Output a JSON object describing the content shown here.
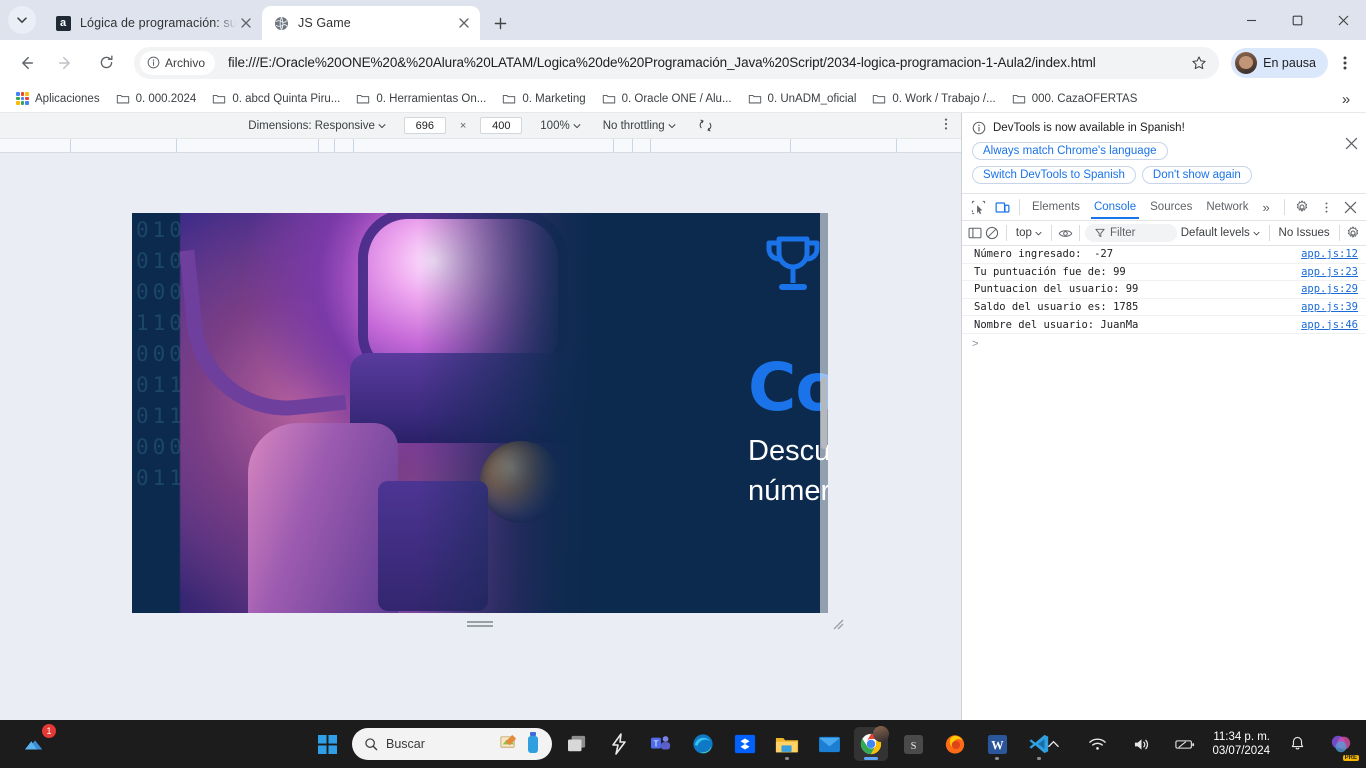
{
  "browser": {
    "tabs": [
      {
        "title": "Lógica de programación: sumér",
        "favicon": "alura-icon",
        "active": false
      },
      {
        "title": "JS Game",
        "favicon": "globe-icon",
        "active": true
      }
    ],
    "new_tab_label": "+",
    "omnibox": {
      "chip_label": "Archivo",
      "url": "file:///E:/Oracle%20ONE%20&%20Alura%20LATAM/Logica%20de%20Programación_Java%20Script/2034-logica-programacion-1-Aula2/index.html"
    },
    "profile_label": "En pausa",
    "bookmarks": [
      {
        "label": "Aplicaciones",
        "icon": "apps-grid-icon"
      },
      {
        "label": "0. 000.2024",
        "icon": "folder-icon"
      },
      {
        "label": "0. abcd Quinta Piru...",
        "icon": "folder-icon"
      },
      {
        "label": "0. Herramientas On...",
        "icon": "folder-icon"
      },
      {
        "label": "0. Marketing",
        "icon": "folder-icon"
      },
      {
        "label": "0. Oracle ONE / Alu...",
        "icon": "folder-icon"
      },
      {
        "label": "0. UnADM_oficial",
        "icon": "folder-icon"
      },
      {
        "label": "0. Work / Trabajo /...",
        "icon": "folder-icon"
      },
      {
        "label": "000. CazaOFERTAS",
        "icon": "folder-icon"
      }
    ],
    "bookmarks_overflow": "»"
  },
  "device_toolbar": {
    "dimensions_label": "Dimensions: Responsive",
    "width": "696",
    "height": "400",
    "multiply": "×",
    "zoom": "100%",
    "throttling": "No throttling"
  },
  "page": {
    "heading": "Comienza el juego",
    "paragraph_line1": "Descubre el",
    "paragraph_line2": "número secreto",
    "trophy_icon": "trophy-icon",
    "accent_color": "#1a73e8",
    "background_color": "#0c2a4d",
    "binary_text": "0101 110  1\n010 0  0  0    0\n000 011 0010001 1  0\n11010 001  1101    01\n0000  0      010001101 0\n0110 10   01000     0\n011100  0 00110   1010\n000011 0  0 11 1  011 100\n0110  1 0  0011 0"
  },
  "devtools": {
    "banner": {
      "title": "DevTools is now available in Spanish!",
      "buttons": [
        "Always match Chrome's language",
        "Switch DevTools to Spanish",
        "Don't show again"
      ],
      "close_icon": "close-icon"
    },
    "tabs": [
      "Elements",
      "Console",
      "Sources",
      "Network"
    ],
    "active_tab": "Console",
    "tabs_overflow": "»",
    "filterbar": {
      "context": "top",
      "filter_placeholder": "Filter",
      "levels": "Default levels",
      "issues": "No Issues"
    },
    "console_messages": [
      {
        "text": "Número ingresado:  -27",
        "source": "app.js:12"
      },
      {
        "text": "Tu puntuación fue de: 99",
        "source": "app.js:23"
      },
      {
        "text": "Puntuacion del usuario: 99",
        "source": "app.js:29"
      },
      {
        "text": "Saldo del usuario es: 1785",
        "source": "app.js:39"
      },
      {
        "text": "Nombre del usuario: JuanMa",
        "source": "app.js:46"
      }
    ],
    "prompt_symbol": ">"
  },
  "taskbar": {
    "search_placeholder": "Buscar",
    "notification_badge": "1",
    "time": "11:34 p. m.",
    "date": "03/07/2024",
    "apps": [
      "dropbox",
      "file-explorer",
      "mail",
      "chrome",
      "s-app",
      "firefox",
      "word",
      "vscode"
    ]
  }
}
